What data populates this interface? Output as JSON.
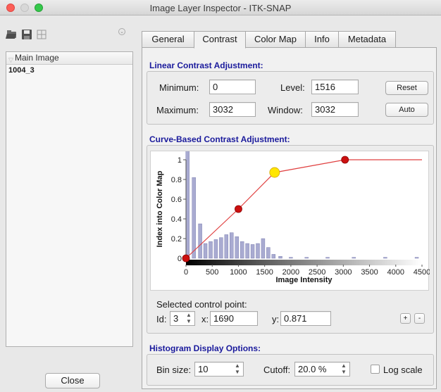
{
  "window": {
    "title": "Image Layer Inspector - ITK-SNAP"
  },
  "layers": {
    "header": "Main Image",
    "item_name": "1004_3"
  },
  "close_label": "Close",
  "tabs": [
    {
      "label": "General"
    },
    {
      "label": "Contrast"
    },
    {
      "label": "Color Map"
    },
    {
      "label": "Info"
    },
    {
      "label": "Metadata"
    }
  ],
  "linear": {
    "title": "Linear Contrast Adjustment:",
    "min_label": "Minimum:",
    "min_value": "0",
    "max_label": "Maximum:",
    "max_value": "3032",
    "level_label": "Level:",
    "level_value": "1516",
    "window_label": "Window:",
    "window_value": "3032",
    "reset_label": "Reset",
    "auto_label": "Auto"
  },
  "curve": {
    "title": "Curve-Based Contrast Adjustment:",
    "selected_label": "Selected control point:",
    "id_label": "Id:",
    "id_value": "3",
    "x_label": "x:",
    "x_value": "1690",
    "y_label": "y:",
    "y_value": "0.871",
    "plus_label": "+",
    "minus_label": "-"
  },
  "histogram_options": {
    "title": "Histogram Display Options:",
    "bin_label": "Bin size:",
    "bin_value": "10",
    "cutoff_label": "Cutoff:",
    "cutoff_value": "20.0 %",
    "log_label": "Log scale",
    "log_checked": false
  },
  "chart_data": {
    "type": "line",
    "xlabel": "Image Intensity",
    "ylabel": "Index into Color Map",
    "xlim": [
      0,
      4500
    ],
    "ylim": [
      0,
      1
    ],
    "xticks": [
      "0",
      "500",
      "1000",
      "1500",
      "2000",
      "2500",
      "3000",
      "3500",
      "4000",
      "4500"
    ],
    "yticks": [
      "0",
      "0.2",
      "0.4",
      "0.6",
      "0.8",
      "1"
    ],
    "control_points": [
      {
        "x": 0,
        "y": 0
      },
      {
        "x": 1000,
        "y": 0.5
      },
      {
        "x": 1690,
        "y": 0.871
      },
      {
        "x": 3032,
        "y": 1
      }
    ],
    "curve_end": {
      "x": 4500,
      "y": 1
    },
    "selected_point": 2,
    "curve_color": "#e04040",
    "point_color": "#cc1010",
    "selected_color": "#ffe600",
    "histogram_color": "#a9abd1",
    "histogram": [
      {
        "x": 30,
        "y": 1.12
      },
      {
        "x": 150,
        "y": 0.82
      },
      {
        "x": 270,
        "y": 0.35
      },
      {
        "x": 370,
        "y": 0.15
      },
      {
        "x": 470,
        "y": 0.17
      },
      {
        "x": 570,
        "y": 0.19
      },
      {
        "x": 670,
        "y": 0.21
      },
      {
        "x": 770,
        "y": 0.24
      },
      {
        "x": 870,
        "y": 0.26
      },
      {
        "x": 970,
        "y": 0.22
      },
      {
        "x": 1070,
        "y": 0.17
      },
      {
        "x": 1170,
        "y": 0.15
      },
      {
        "x": 1270,
        "y": 0.14
      },
      {
        "x": 1370,
        "y": 0.15
      },
      {
        "x": 1470,
        "y": 0.2
      },
      {
        "x": 1570,
        "y": 0.11
      },
      {
        "x": 1670,
        "y": 0.04
      },
      {
        "x": 1800,
        "y": 0.02
      },
      {
        "x": 2000,
        "y": 0.01
      },
      {
        "x": 2300,
        "y": 0.01
      },
      {
        "x": 2700,
        "y": 0.01
      },
      {
        "x": 3200,
        "y": 0.01
      },
      {
        "x": 3800,
        "y": 0.01
      },
      {
        "x": 4400,
        "y": 0.01
      }
    ]
  }
}
